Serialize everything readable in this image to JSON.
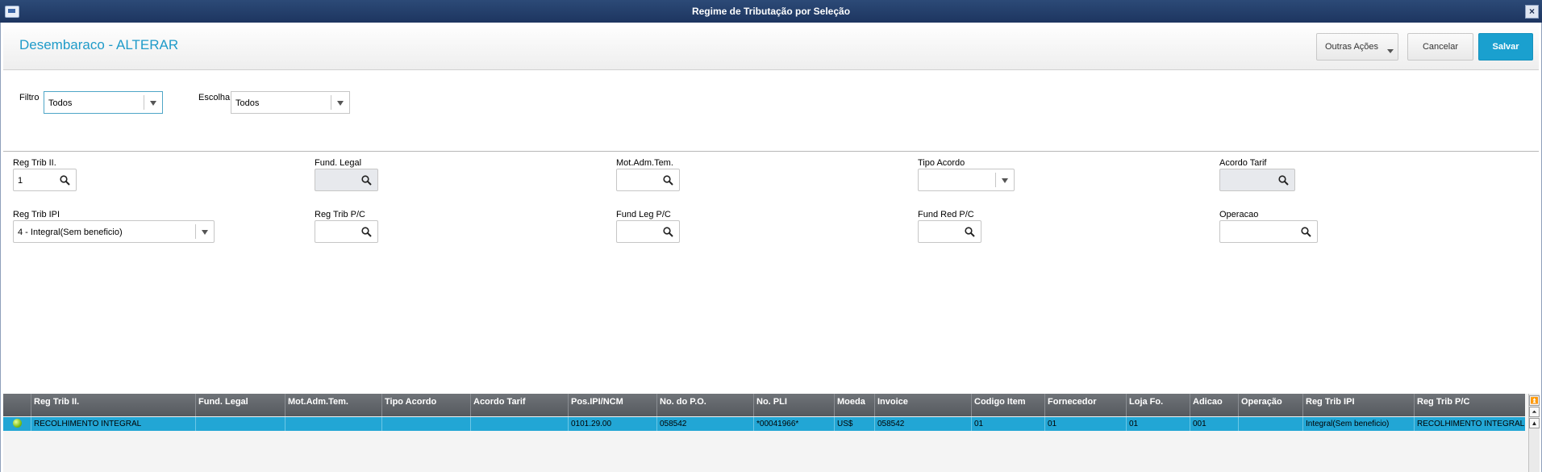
{
  "window": {
    "title": "Regime de Tributação por Seleção"
  },
  "header": {
    "title": "Desembaraco - ALTERAR",
    "outras_acoes": "Outras Ações",
    "cancelar": "Cancelar",
    "salvar": "Salvar"
  },
  "filter": {
    "filtro_label": "Filtro",
    "filtro_value": "Todos",
    "escolha_label": "Escolha",
    "escolha_value": "Todos"
  },
  "form": {
    "reg_trib_ii": {
      "label": "Reg Trib II.",
      "value": "1"
    },
    "fund_legal": {
      "label": "Fund. Legal",
      "value": ""
    },
    "mot_adm_tem": {
      "label": "Mot.Adm.Tem.",
      "value": ""
    },
    "tipo_acordo": {
      "label": "Tipo Acordo",
      "value": ""
    },
    "acordo_tarif": {
      "label": "Acordo Tarif",
      "value": ""
    },
    "reg_trib_ipi": {
      "label": "Reg Trib IPI",
      "value": "4 - Integral(Sem beneficio)"
    },
    "reg_trib_pc": {
      "label": "Reg Trib P/C",
      "value": ""
    },
    "fund_leg_pc": {
      "label": "Fund Leg P/C",
      "value": ""
    },
    "fund_red_pc": {
      "label": "Fund Red P/C",
      "value": ""
    },
    "operacao": {
      "label": "Operacao",
      "value": ""
    }
  },
  "grid": {
    "columns": [
      "Reg Trib II.",
      "Fund. Legal",
      "Mot.Adm.Tem.",
      "Tipo Acordo",
      "Acordo Tarif",
      "Pos.IPI/NCM",
      "No. do P.O.",
      "No. PLI",
      "Moeda",
      "Invoice",
      "Codigo Item",
      "Fornecedor",
      "Loja Fo.",
      "Adicao",
      "Operação",
      "Reg Trib IPI",
      "Reg Trib P/C"
    ],
    "rows": [
      [
        "RECOLHIMENTO INTEGRAL",
        "",
        "",
        "",
        "",
        "0101.29.00",
        "058542",
        "*00041966*",
        "US$",
        "058542",
        "01",
        "01",
        "01",
        "001",
        "",
        "Integral(Sem beneficio)",
        "RECOLHIMENTO INTEGRAL"
      ]
    ]
  },
  "icons": {
    "lookup": "magnifier-icon",
    "dropdown": "chevron-down-icon",
    "status": "green-ball-icon"
  }
}
